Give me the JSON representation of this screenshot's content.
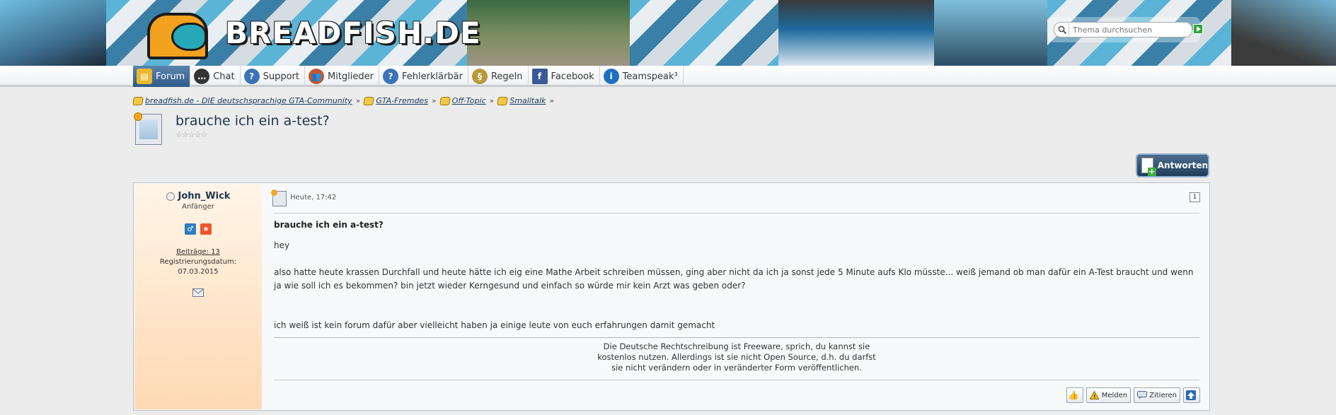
{
  "header": {
    "logo_text": "BREADFISH.DE",
    "search_placeholder": "Thema durchsuchen"
  },
  "nav": [
    {
      "label": "Forum",
      "icon": "forum-icon",
      "color": "#e8b92f"
    },
    {
      "label": "Chat",
      "icon": "chat-icon",
      "color": "#333333"
    },
    {
      "label": "Support",
      "icon": "help-icon",
      "color": "#3b73b8"
    },
    {
      "label": "Mitglieder",
      "icon": "members-icon",
      "color": "#c0572f"
    },
    {
      "label": "Fehlerklärbär",
      "icon": "help-icon",
      "color": "#3b73b8"
    },
    {
      "label": "Regeln",
      "icon": "paragraph-icon",
      "color": "#b89a3a"
    },
    {
      "label": "Facebook",
      "icon": "facebook-icon",
      "color": "#3b5998"
    },
    {
      "label": "Teamspeak³",
      "icon": "info-icon",
      "color": "#1e6fc0"
    }
  ],
  "breadcrumb": [
    "breadfish.de - DIE deutschsprachige GTA-Community",
    "GTA-Fremdes",
    "Off-Topic",
    "Smalltalk"
  ],
  "breadcrumb_sep": "»",
  "thread": {
    "title": "brauche ich ein a-test?",
    "stars": "☆☆☆☆☆",
    "reply_label": "Antworten"
  },
  "post": {
    "author": "John_Wick",
    "rank": "Anfänger",
    "posts": "Beiträge: 13",
    "reg_label": "Registrierungsdatum:",
    "reg_date": "07.03.2015",
    "date": "Heute, 17:42",
    "number": "1",
    "title": "brauche ich ein a-test?",
    "body_line1": "hey",
    "body_para2": "also hatte heute krassen Durchfall und heute hätte ich eig eine Mathe Arbeit schreiben müssen, ging aber nicht da ich ja sonst jede 5 Minute aufs Klo müsste... weiß jemand ob man dafür ein A-Test braucht und wenn ja wie soll ich es bekommen? bin jetzt wieder Kerngesund und einfach so würde mir kein Arzt was geben oder?",
    "body_para3": "ich weiß ist kein forum dafür aber vielleicht haben ja einige leute von euch erfahrungen damit gemacht",
    "signature": [
      "Die Deutsche Rechtschreibung ist Freeware, sprich, du kannst sie",
      "kostenlos nutzen. Allerdings ist sie nicht Open Source, d.h. du darfst",
      "sie nicht verändern oder in veränderter Form veröffentlichen."
    ],
    "actions": {
      "report": "Melden",
      "quote": "Zitieren"
    }
  },
  "colors": {
    "accent": "#2f5b89",
    "title": "#1d3650",
    "sidebar_bg": "#ffd9b3"
  }
}
